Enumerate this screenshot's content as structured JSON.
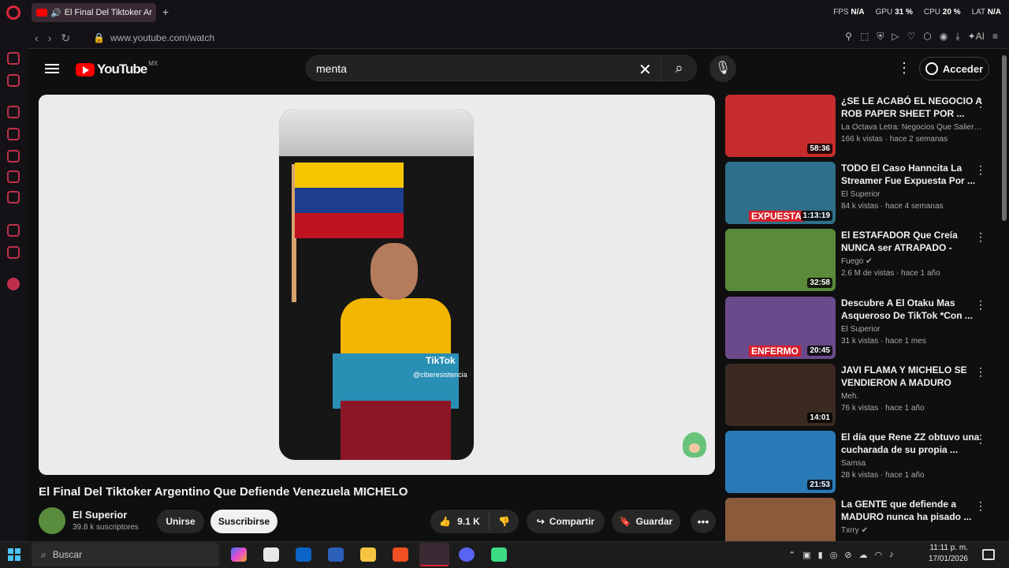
{
  "browser": {
    "tab_title": "El Final Del Tiktoker Ar",
    "new_tab": "+",
    "stats": [
      {
        "label": "FPS",
        "value": "N/A"
      },
      {
        "label": "GPU",
        "value": "31 %"
      },
      {
        "label": "CPU",
        "value": "20 %"
      },
      {
        "label": "LAT",
        "value": "N/A"
      }
    ],
    "url": "www.youtube.com/watch",
    "ai_label": "AI"
  },
  "youtube": {
    "logo_text": "YouTube",
    "region": "MX",
    "search_value": "menta",
    "signin_label": "Acceder"
  },
  "video": {
    "tiktok_label": "TikTok",
    "tiktok_handle": "@ciberesistencia",
    "title": "El Final Del Tiktoker Argentino Que Defiende Venezuela MICHELO",
    "channel": "El Superior",
    "subscribers": "39.8 k suscriptores",
    "join_label": "Unirse",
    "subscribe_label": "Suscribirse",
    "likes": "9.1 K",
    "share_label": "Compartir",
    "save_label": "Guardar"
  },
  "recommendations": [
    {
      "title": "¿SE LE ACABÓ EL NEGOCIO A ROB PAPER SHEET POR ...",
      "channel": "La Octava Letra: Negocios Que Salieron ...",
      "views": "166 k vistas · hace 2 semanas",
      "duration": "58:36",
      "caption": "",
      "thumb_color": "#c72c2c"
    },
    {
      "title": "TODO El Caso Hanncita La Streamer Fue Expuesta Por ...",
      "channel": "El Superior",
      "views": "84 k vistas · hace 4 semanas",
      "duration": "1:13:19",
      "caption": "EXPUESTA",
      "thumb_color": "#2f6f8a"
    },
    {
      "title": "El ESTAFADOR Que Creía NUNCA ser ATRAPADO - Caso...",
      "channel": "Fuego",
      "views": "2.6 M de vistas · hace 1 año",
      "duration": "32:58",
      "caption": "",
      "thumb_color": "#5b8a3a"
    },
    {
      "title": "Descubre A El Otaku Mas Asqueroso De TikTok *Con ...",
      "channel": "El Superior",
      "views": "31 k vistas · hace 1 mes",
      "duration": "20:45",
      "caption": "ENFERMO",
      "thumb_color": "#6a4a8a"
    },
    {
      "title": "JAVI FLAMA Y MICHELO SE VENDIERON A MADURO",
      "channel": "Meh.",
      "views": "76 k vistas · hace 1 año",
      "duration": "14:01",
      "caption": "",
      "thumb_color": "#3a2a22"
    },
    {
      "title": "El día que Rene ZZ obtuvo una cucharada de su propia ...",
      "channel": "Samsa",
      "views": "28 k vistas · hace 1 año",
      "duration": "21:53",
      "caption": "",
      "thumb_color": "#2a7ab8"
    },
    {
      "title": "La GENTE que defiende a MADURO nunca ha pisado ...",
      "channel": "Txrry",
      "views": "",
      "duration": "",
      "caption": "",
      "thumb_color": "#8a5a3a"
    }
  ],
  "taskbar": {
    "search_placeholder": "Buscar",
    "time": "11:11 p. m.",
    "date": "17/01/2026"
  }
}
